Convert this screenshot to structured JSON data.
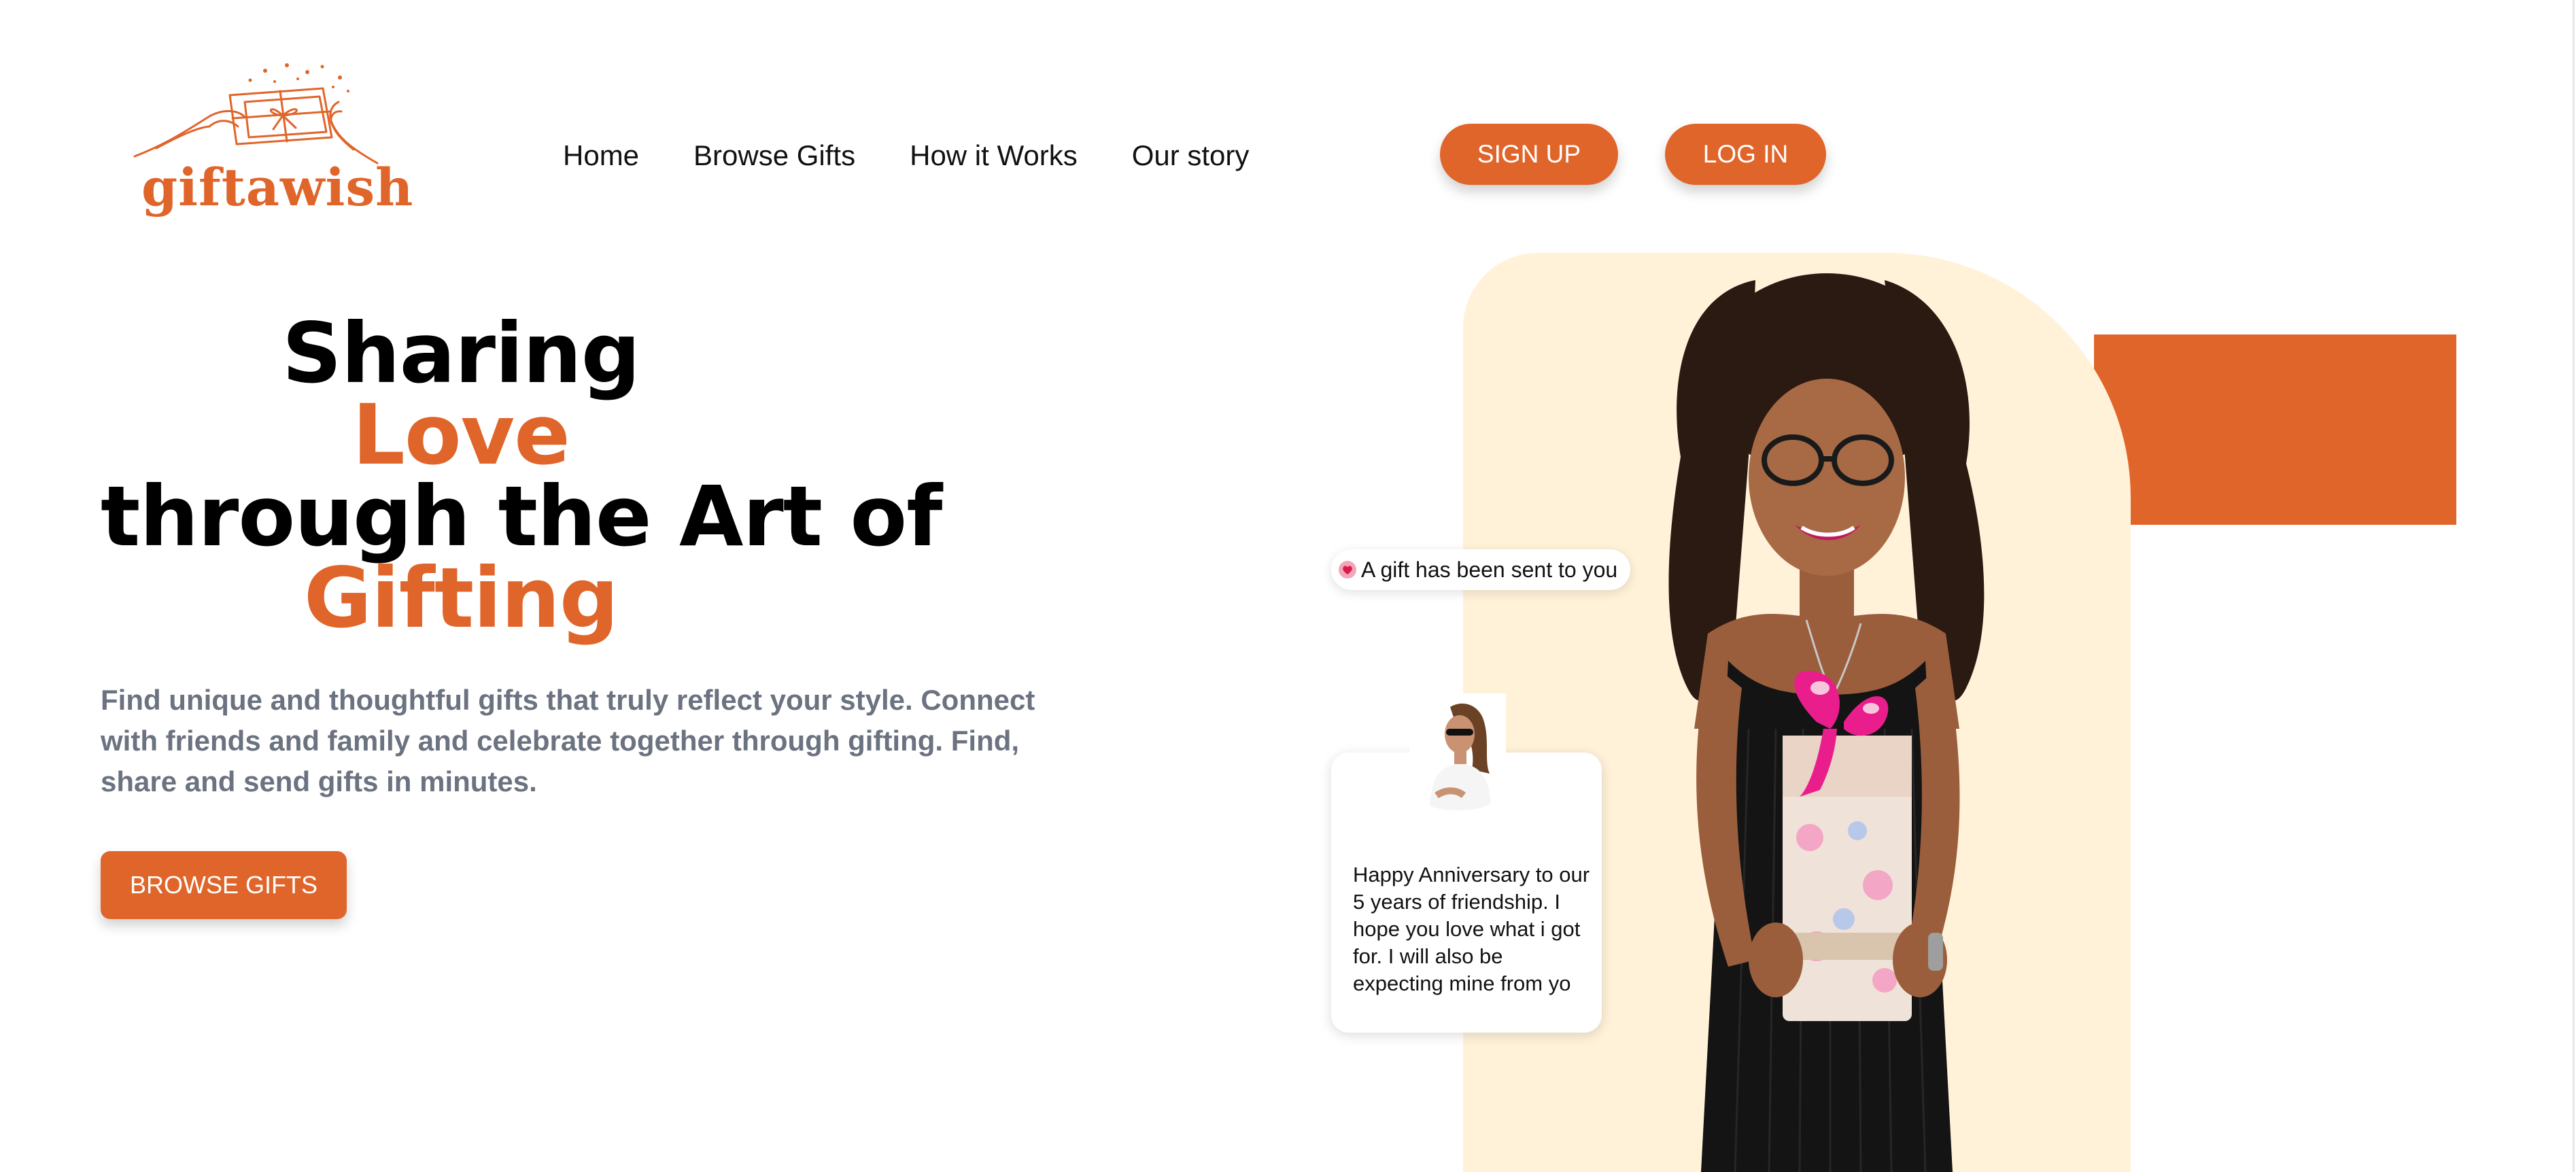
{
  "brand": {
    "name": "giftawish",
    "accent_color": "#e0652a",
    "cream_color": "#fff2d9"
  },
  "nav": {
    "links": [
      {
        "label": "Home"
      },
      {
        "label": "Browse Gifts"
      },
      {
        "label": "How it Works"
      },
      {
        "label": "Our story"
      }
    ],
    "signup_label": "SIGN UP",
    "login_label": "LOG IN"
  },
  "hero": {
    "headline": {
      "line1": "Sharing",
      "line2": "Love",
      "line3": "through the Art of",
      "line4": "Gifting"
    },
    "description": "Find unique and thoughtful gifts that truly reflect your style. Connect with friends and family and celebrate together through gifting. Find, share and send gifts in minutes.",
    "cta_label": "BROWSE GIFTS"
  },
  "visual": {
    "notification_text": "A gift has been sent to you",
    "notification_icon": "heart-icon",
    "message_text": "Happy Anniversary to our 5 years of friendship. I hope you love what i got for. I will also be expecting mine from yo"
  }
}
